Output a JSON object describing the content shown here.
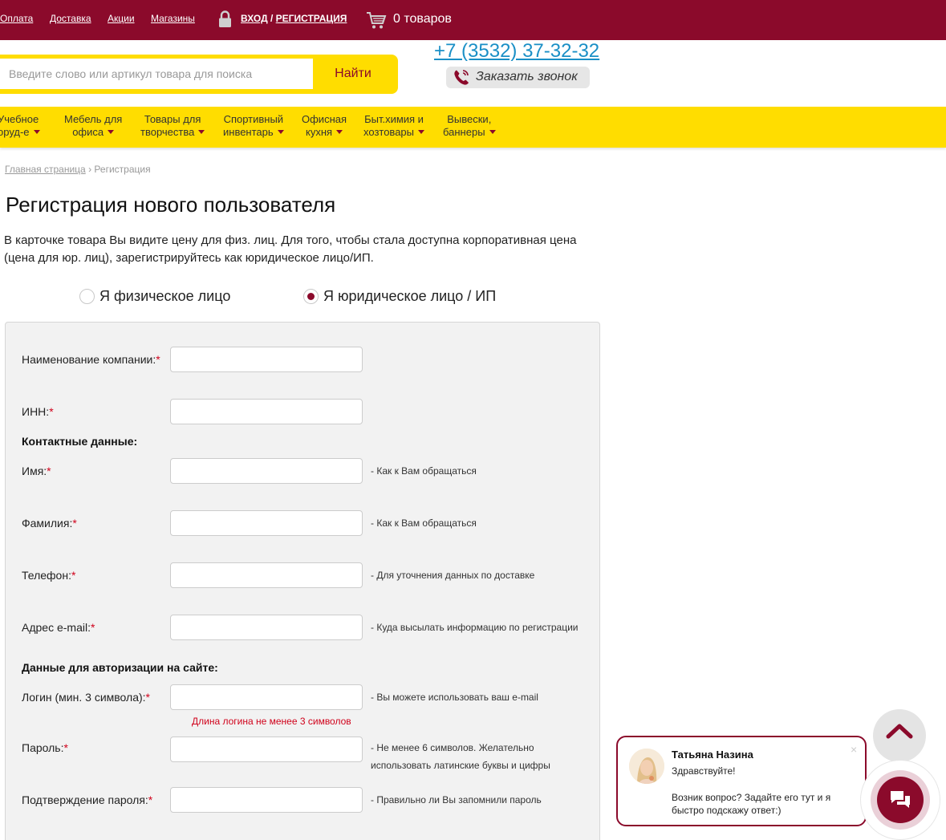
{
  "topbar": {
    "links": [
      "Оплата",
      "Доставка",
      "Акции",
      "Магазины"
    ],
    "login_label": "ВХОД",
    "separator": "/",
    "register_label": "РЕГИСТРАЦИЯ",
    "cart_label": "0 товаров",
    "bg_color": "#8b0a2b"
  },
  "header": {
    "search_placeholder": "Введите слово или артикул товара для поиска",
    "search_button": "Найти",
    "phone": "+7 (3532) 37-32-32",
    "callback_label": "Заказать звонок"
  },
  "nav": {
    "items": [
      {
        "line1": "Учебное",
        "line2": "оруд-е"
      },
      {
        "line1": "Мебель для",
        "line2": "офиса"
      },
      {
        "line1": "Товары для",
        "line2": "творчества"
      },
      {
        "line1": "Спортивный",
        "line2": "инвентарь"
      },
      {
        "line1": "Офисная",
        "line2": "кухня"
      },
      {
        "line1": "Быт.химия и",
        "line2": "хозтовары"
      },
      {
        "line1": "Вывески,",
        "line2": "баннеры"
      }
    ],
    "accent_color": "#ffdd00"
  },
  "breadcrumb": {
    "home": "Главная страница",
    "sep": "›",
    "current": "Регистрация"
  },
  "page": {
    "title": "Регистрация нового пользователя",
    "intro": "В  карточке товара Вы видите цену для физ. лиц. Для того, чтобы стала доступна корпоративная цена (цена для юр. лиц), зарегистрируйтесь как юридическое лицо/ИП."
  },
  "account_type": {
    "individual": "Я физическое лицо",
    "legal": "Я юридическое лицо / ИП",
    "selected": "legal"
  },
  "form": {
    "required_mark": "*",
    "company": {
      "label": "Наименование компании:"
    },
    "inn": {
      "label": "ИНН:"
    },
    "contacts_title": "Контактные данные:",
    "first_name": {
      "label": "Имя:",
      "hint": "- Как к Вам обращаться"
    },
    "last_name": {
      "label": "Фамилия:",
      "hint": "- Как к Вам обращаться"
    },
    "phone": {
      "label": "Телефон:",
      "hint": "- Для уточнения данных по доставке"
    },
    "email": {
      "label": "Адрес e-mail:",
      "hint": "- Куда высылать информацию по регистрации"
    },
    "auth_title": "Данные для авторизации на сайте:",
    "login": {
      "label": "Логин (мин. 3 символа):",
      "hint": "- Вы можете использовать ваш e-mail",
      "error": "Длина логина не менее 3 символов"
    },
    "password": {
      "label": "Пароль:",
      "hint_line1": "- Не менее 6 символов. Желательно",
      "hint_line2": "использовать латинские буквы и цифры"
    },
    "password_confirm": {
      "label": "Подтверждение пароля:",
      "hint": "- Правильно ли Вы запомнили пароль"
    }
  },
  "chat": {
    "operator_name": "Татьяна Назина",
    "greeting": "Здравствуйте!",
    "message": "Возник вопрос? Задайте его тут и я быстро подскажу ответ:)",
    "close_symbol": "×"
  },
  "icons": {
    "lock": "lock-icon",
    "cart": "cart-icon",
    "phone": "phone-icon",
    "scroll_top": "chevron-up-icon",
    "chat": "chat-bubbles-icon"
  }
}
